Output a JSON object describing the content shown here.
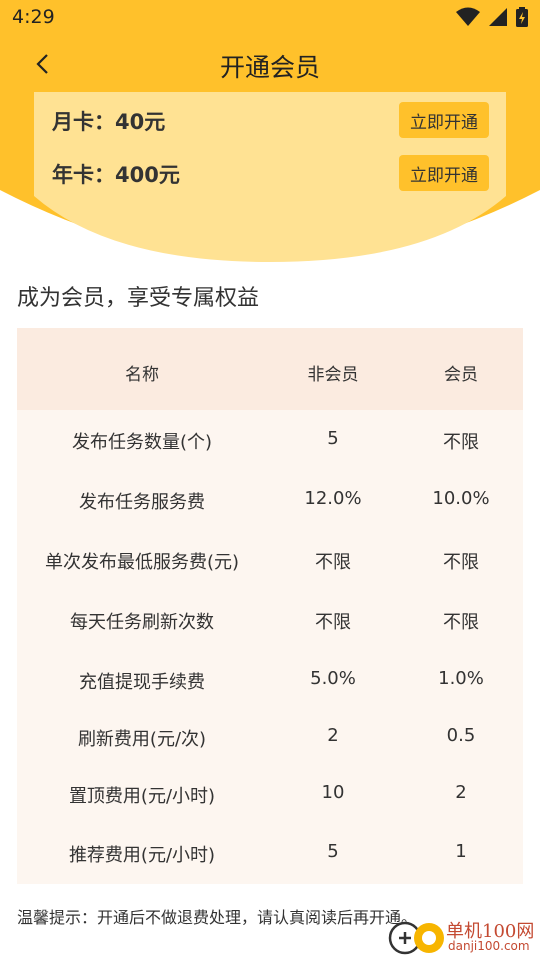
{
  "status_bar": {
    "time": "4:29",
    "icons": [
      "wifi-icon",
      "signal-icon",
      "battery-charging-icon"
    ]
  },
  "header": {
    "title": "开通会员",
    "back_icon": "chevron-left-icon"
  },
  "plans": [
    {
      "label": "月卡：40元",
      "button": "立即开通"
    },
    {
      "label": "年卡：400元",
      "button": "立即开通"
    }
  ],
  "benefits": {
    "title": "成为会员，享受专属权益",
    "columns": [
      "名称",
      "非会员",
      "会员"
    ],
    "rows": [
      [
        "发布任务数量(个)",
        "5",
        "不限"
      ],
      [
        "发布任务服务费",
        "12.0%",
        "10.0%"
      ],
      [
        "单次发布最低服务费(元)",
        "不限",
        "不限"
      ],
      [
        "每天任务刷新次数",
        "不限",
        "不限"
      ],
      [
        "充值提现手续费",
        "5.0%",
        "1.0%"
      ],
      [
        "刷新费用(元/次)",
        "2",
        "0.5"
      ],
      [
        "置顶费用(元/小时)",
        "10",
        "2"
      ],
      [
        "推荐费用(元/小时)",
        "5",
        "1"
      ]
    ]
  },
  "tip": "温馨提示：开通后不做退费处理，请认真阅读后再开通。",
  "watermark": {
    "title": "单机100网",
    "subtitle": "danji100.com"
  },
  "colors": {
    "header_yellow": "#ffc12b",
    "card_yellow": "#ffe293",
    "table_bg": "#fdf6f0",
    "table_head": "#fbebe0"
  }
}
